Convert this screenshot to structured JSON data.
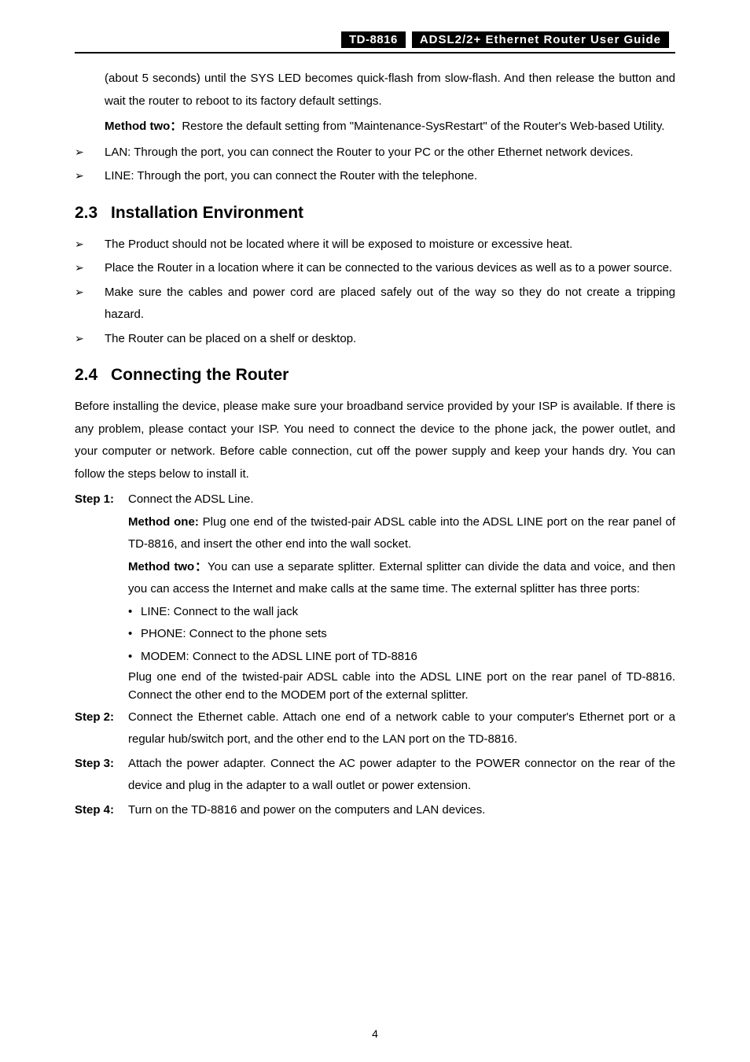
{
  "header": {
    "model": "TD-8816",
    "title": "ADSL2/2+  Ethernet  Router  User  Guide"
  },
  "intro_block": {
    "pre_text": "(about 5 seconds) until the SYS LED becomes quick-flash from slow-flash. And then release the button and wait the router to reboot to its factory default settings.",
    "method_two_label": "Method two：",
    "method_two_text": "Restore the default setting from \"Maintenance-SysRestart\" of the Router's Web-based Utility.",
    "bullets": [
      "LAN: Through the port, you can connect the Router to your PC or the other Ethernet network devices.",
      "LINE: Through the port, you can connect the Router with the telephone."
    ]
  },
  "section_2_3": {
    "number": "2.3",
    "title": "Installation Environment",
    "bullets": [
      "The Product should not be located where it will be exposed to moisture or excessive heat.",
      "Place the Router in a location where it can be connected to the various devices as well as to a power source.",
      "Make sure the cables and power cord are placed safely out of the way so they do not create a tripping hazard.",
      "The Router can be placed on a shelf or desktop."
    ]
  },
  "section_2_4": {
    "number": "2.4",
    "title": "Connecting the Router",
    "intro": "Before installing the device, please make sure your broadband service provided by your ISP is available. If there is any problem, please contact your ISP. You need to connect the device to the phone jack, the power outlet, and your computer or network. Before cable connection, cut off the power supply and keep your hands dry. You can follow the steps below to install it.",
    "steps": [
      {
        "label": "Step 1:",
        "lead": "Connect the ADSL Line.",
        "method_one_label": "Method one:",
        "method_one_text": " Plug one end of the twisted-pair ADSL cable into the ADSL LINE port on the rear panel of TD-8816, and insert the other end into the wall socket.",
        "method_two_label": "Method two：",
        "method_two_text": "You can use a separate splitter. External splitter can divide the data and voice, and then you can access the Internet and make calls at the same time. The external splitter has three ports:",
        "ports": [
          "LINE: Connect to the wall jack",
          "PHONE: Connect to the phone sets",
          "MODEM: Connect to the ADSL LINE port of TD-8816"
        ],
        "tail": "Plug one end of the twisted-pair ADSL cable into the ADSL LINE port on the rear panel of TD-8816. Connect the other end to the MODEM port of the external splitter."
      },
      {
        "label": "Step 2:",
        "text": "Connect the Ethernet cable. Attach one end of a network cable to your computer's Ethernet port or a regular hub/switch port, and the other end to the LAN port on the TD-8816."
      },
      {
        "label": "Step 3:",
        "text": "Attach the power adapter. Connect the AC power adapter to the POWER connector on the rear of the device and plug in the adapter to a wall outlet or power extension."
      },
      {
        "label": "Step 4:",
        "text": "Turn on the TD-8816 and power on the computers and LAN devices."
      }
    ]
  },
  "page_number": "4"
}
